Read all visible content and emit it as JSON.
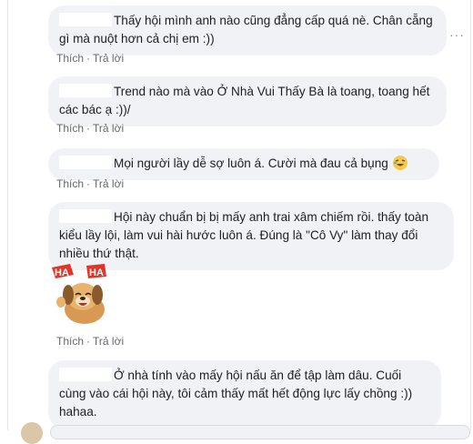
{
  "ui": {
    "like": "Thích",
    "reply": "Trả lời",
    "dot": "·",
    "more": "···"
  },
  "comments": [
    {
      "text": "Thấy hội mình anh nào cũng đẳng cấp quá nè. Chân cẵng gì mà nuột hơn cả chị em :))"
    },
    {
      "text": "Trend nào mà vào Ở Nhà Vui Thấy Bà là toang, toang hết các bác ạ :))/"
    },
    {
      "text": "Mọi người lầy dễ sợ luôn á. Cười mà đau cả bụng"
    },
    {
      "text": "Hội này chuẩn bị bị mấy anh trai xâm chiếm rồi. thấy toàn kiểu lầy lội, làm vui hài hước luôn á. Đúng là \"Cô Vy\" làm thay đổi nhiều thứ thật."
    },
    {
      "text": "Ở nhà tính vào mấy hội nấu ăn để tập làm dâu. Cuối cùng vào cái hội này, tôi cảm thấy mất hết động lực lấy chồng :)) hahaa."
    }
  ],
  "sticker": {
    "label": "HA HA"
  },
  "colors": {
    "bubble": "#f0f2f5",
    "action_text": "#65676b"
  },
  "icons": [
    "more-options-icon",
    "laughing-emoji-icon",
    "haha-dog-sticker"
  ]
}
